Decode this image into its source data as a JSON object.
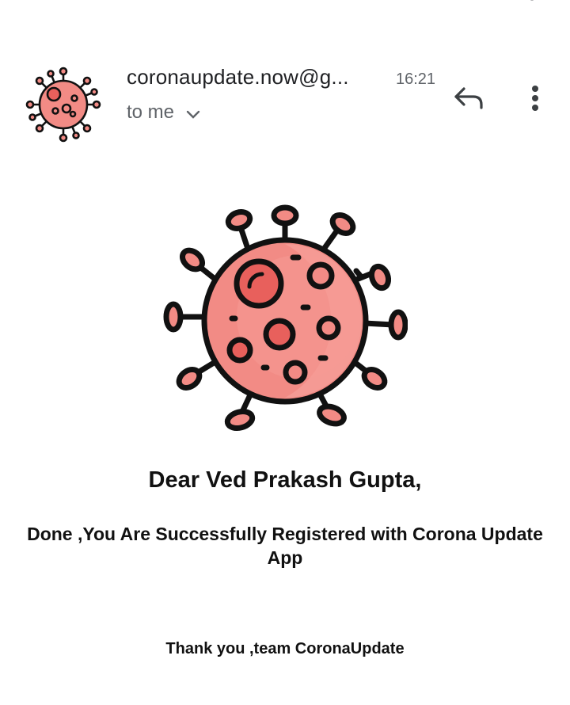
{
  "header": {
    "sender": "coronaupdate.now@g...",
    "time": "16:21",
    "recipient_label": "to me",
    "avatar_icon": "virus-icon",
    "reply_icon": "reply-icon",
    "more_icon": "more-vert-icon",
    "expand_icon": "chevron-down-icon"
  },
  "body": {
    "hero_icon": "virus-icon",
    "greeting": "Dear Ved Prakash Gupta,",
    "message": "Done ,You Are Successfully Registered with Corona Update App",
    "signoff": "Thank you ,team CoronaUpdate"
  },
  "colors": {
    "virus_fill": "#f28b85",
    "virus_light": "#f59a94",
    "virus_spot": "#e8605c",
    "outline": "#111111"
  }
}
